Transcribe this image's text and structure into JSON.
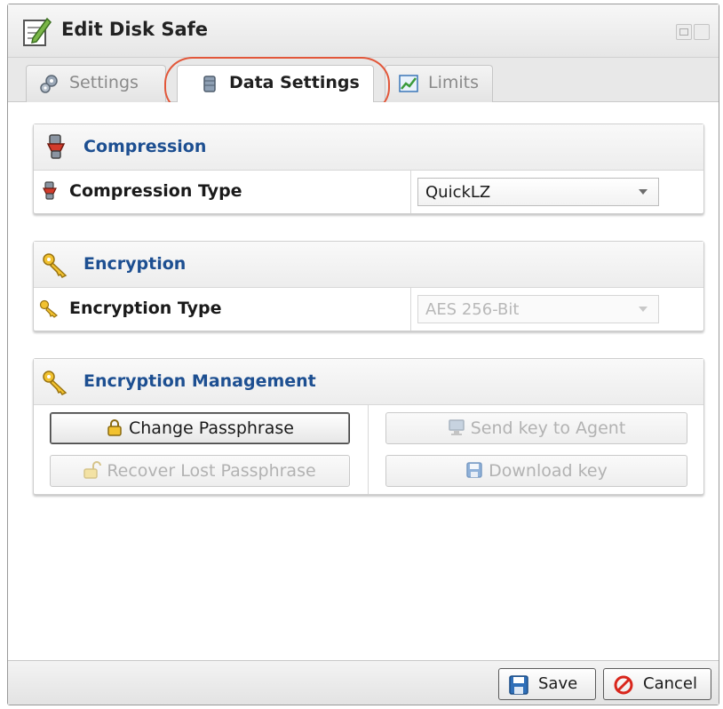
{
  "window": {
    "title": "Edit Disk Safe"
  },
  "tabs": [
    {
      "label": "Settings"
    },
    {
      "label": "Data Settings"
    },
    {
      "label": "Limits"
    }
  ],
  "compression": {
    "heading": "Compression",
    "field_label": "Compression Type",
    "selected": "QuickLZ"
  },
  "encryption": {
    "heading": "Encryption",
    "field_label": "Encryption Type",
    "selected": "AES 256-Bit"
  },
  "encryption_management": {
    "heading": "Encryption Management",
    "change_passphrase": "Change Passphrase",
    "send_key": "Send key to Agent",
    "recover_passphrase": "Recover Lost Passphrase",
    "download_key": "Download key"
  },
  "footer": {
    "save": "Save",
    "cancel": "Cancel"
  },
  "colors": {
    "section_heading": "#1d4f91",
    "highlight_ring": "#e2573a",
    "cancel_icon": "#d9261c",
    "save_icon": "#2f6fb8"
  }
}
